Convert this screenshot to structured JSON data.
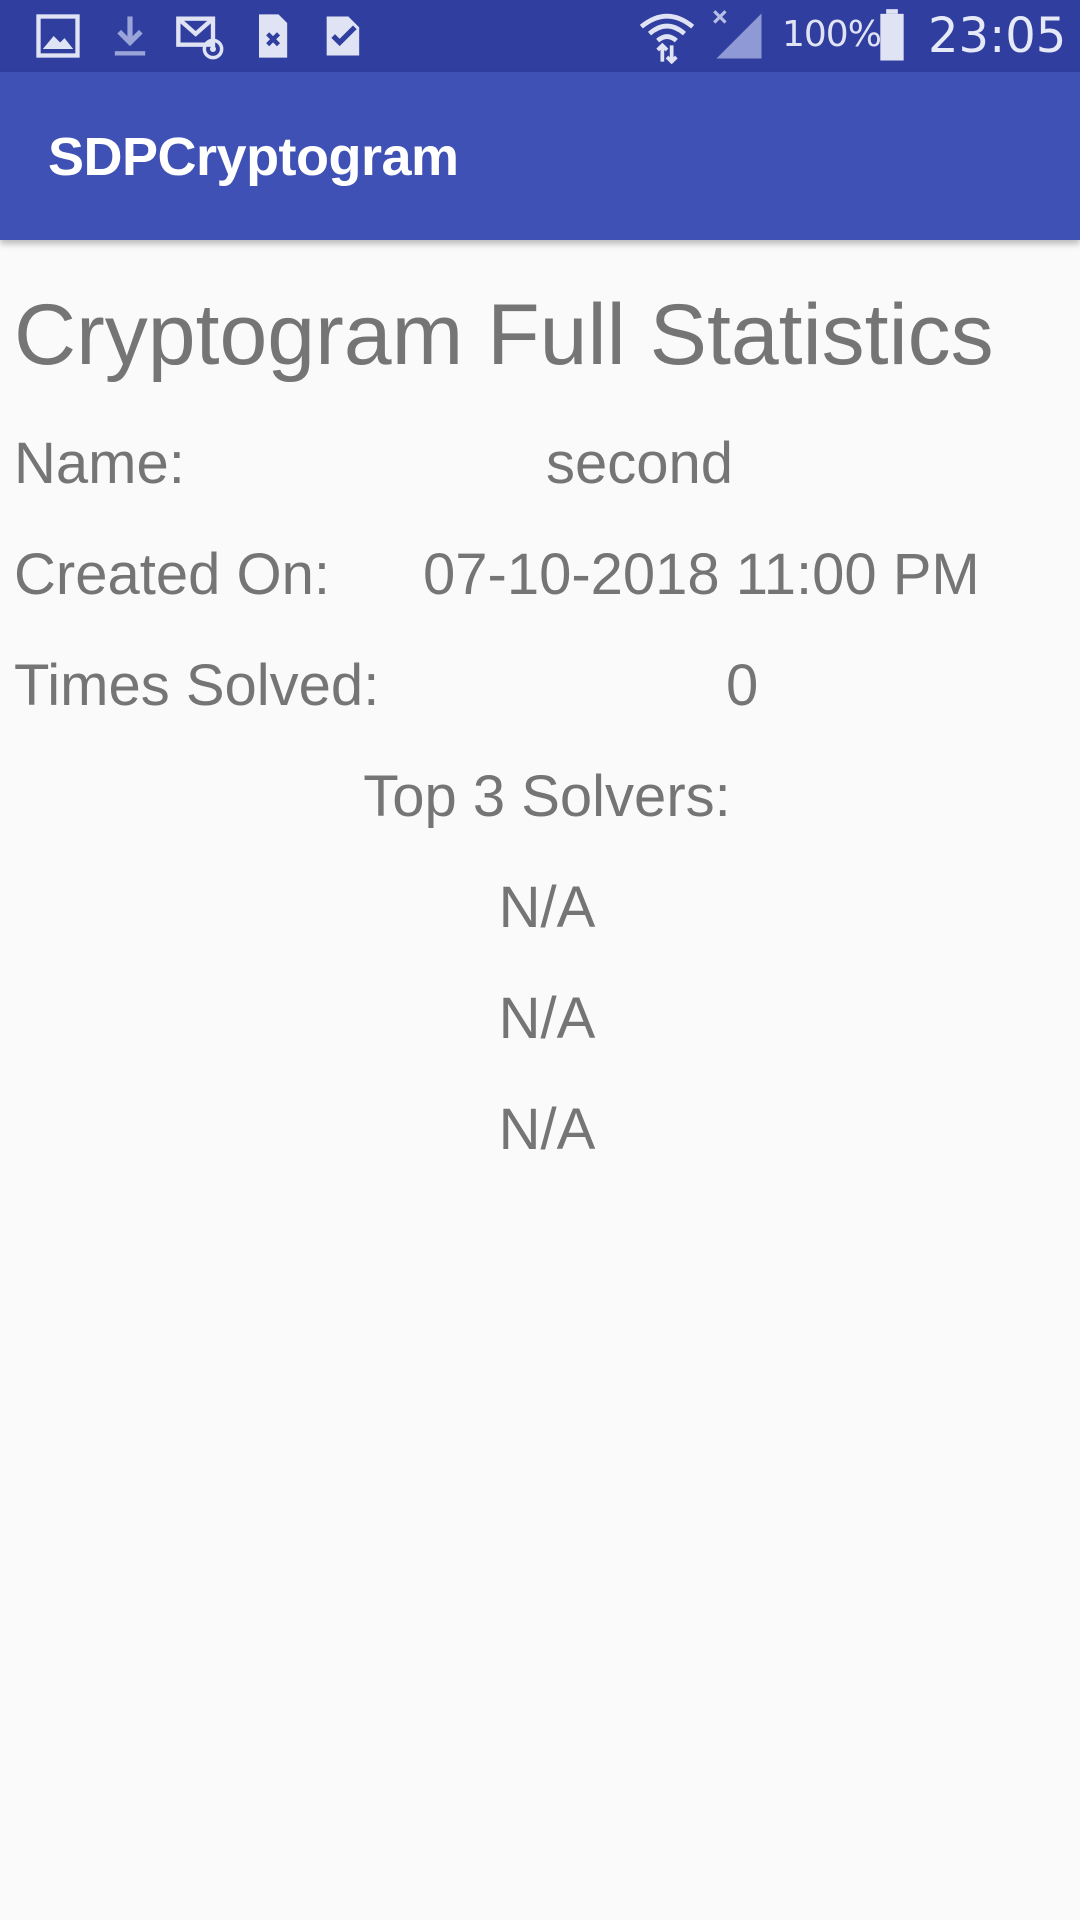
{
  "status_bar": {
    "notification_icons": [
      "gallery-icon",
      "download-icon",
      "email-icon",
      "sim-card-icon",
      "checklist-icon"
    ],
    "battery_percent": "100%",
    "time": "23:05"
  },
  "app_bar": {
    "title": "SDPCryptogram"
  },
  "stats": {
    "page_title": "Cryptogram Full Statistics",
    "name_label": "Name:",
    "name_value": "second",
    "created_label": "Created On:",
    "created_value": "07-10-2018 11:00 PM",
    "solved_label": "Times Solved:",
    "solved_value": "0",
    "top_solvers_label": "Top 3 Solvers:",
    "top_solvers": [
      "N/A",
      "N/A",
      "N/A"
    ]
  },
  "colors": {
    "status_bar": "#303f9f",
    "app_bar": "#3f51b5",
    "background": "#fafafa",
    "text": "#757575"
  }
}
